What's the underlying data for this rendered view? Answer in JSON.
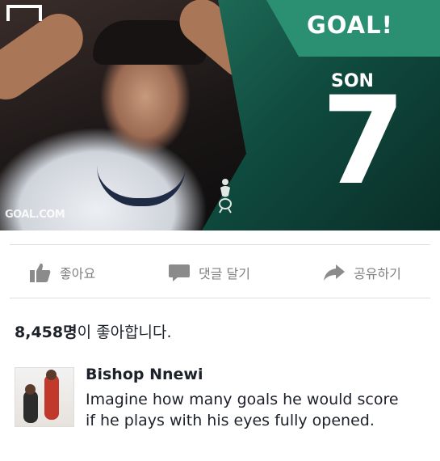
{
  "post_image": {
    "headline": "GOAL!",
    "player": "SON",
    "number": "7",
    "watermark": "GOAL.COM"
  },
  "actions": [
    {
      "label": "좋아요",
      "icon": "thumbs-up-icon"
    },
    {
      "label": "댓글 달기",
      "icon": "comment-bubble-icon"
    },
    {
      "label": "공유하기",
      "icon": "share-arrow-icon"
    }
  ],
  "likes": {
    "count": "8,458명",
    "suffix": "이 좋아합니다."
  },
  "comment": {
    "author": "Bishop Nnewi",
    "text": "Imagine how many goals he would score if he plays with his eyes fully opened."
  },
  "colors": {
    "panel_green": "#1f6b58",
    "action_gray": "#7f7f7f",
    "text": "#1d2129"
  }
}
